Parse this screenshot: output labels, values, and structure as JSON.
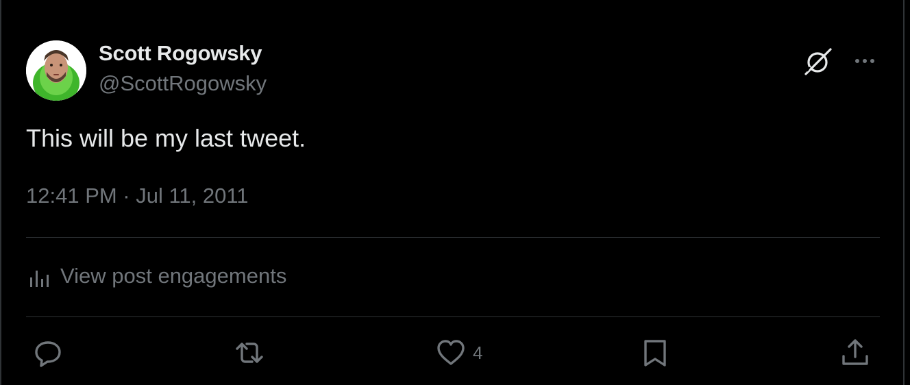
{
  "author": {
    "display_name": "Scott Rogowsky",
    "handle": "@ScottRogowsky"
  },
  "tweet": {
    "text": "This will be my last tweet.",
    "timestamp": "12:41 PM · Jul 11, 2011"
  },
  "engagements": {
    "label": "View post engagements"
  },
  "actions": {
    "reply": {
      "icon": "reply-icon"
    },
    "repost": {
      "icon": "repost-icon"
    },
    "like": {
      "icon": "heart-icon",
      "count": "4"
    },
    "bookmark": {
      "icon": "bookmark-icon"
    },
    "share": {
      "icon": "share-icon"
    }
  },
  "header_icons": [
    "grok-icon",
    "more-icon"
  ],
  "colors": {
    "background": "#000000",
    "primary_text": "#e7e9ea",
    "secondary_text": "#71767b",
    "divider": "#2f3336",
    "avatar_green": "#3fb52b"
  }
}
